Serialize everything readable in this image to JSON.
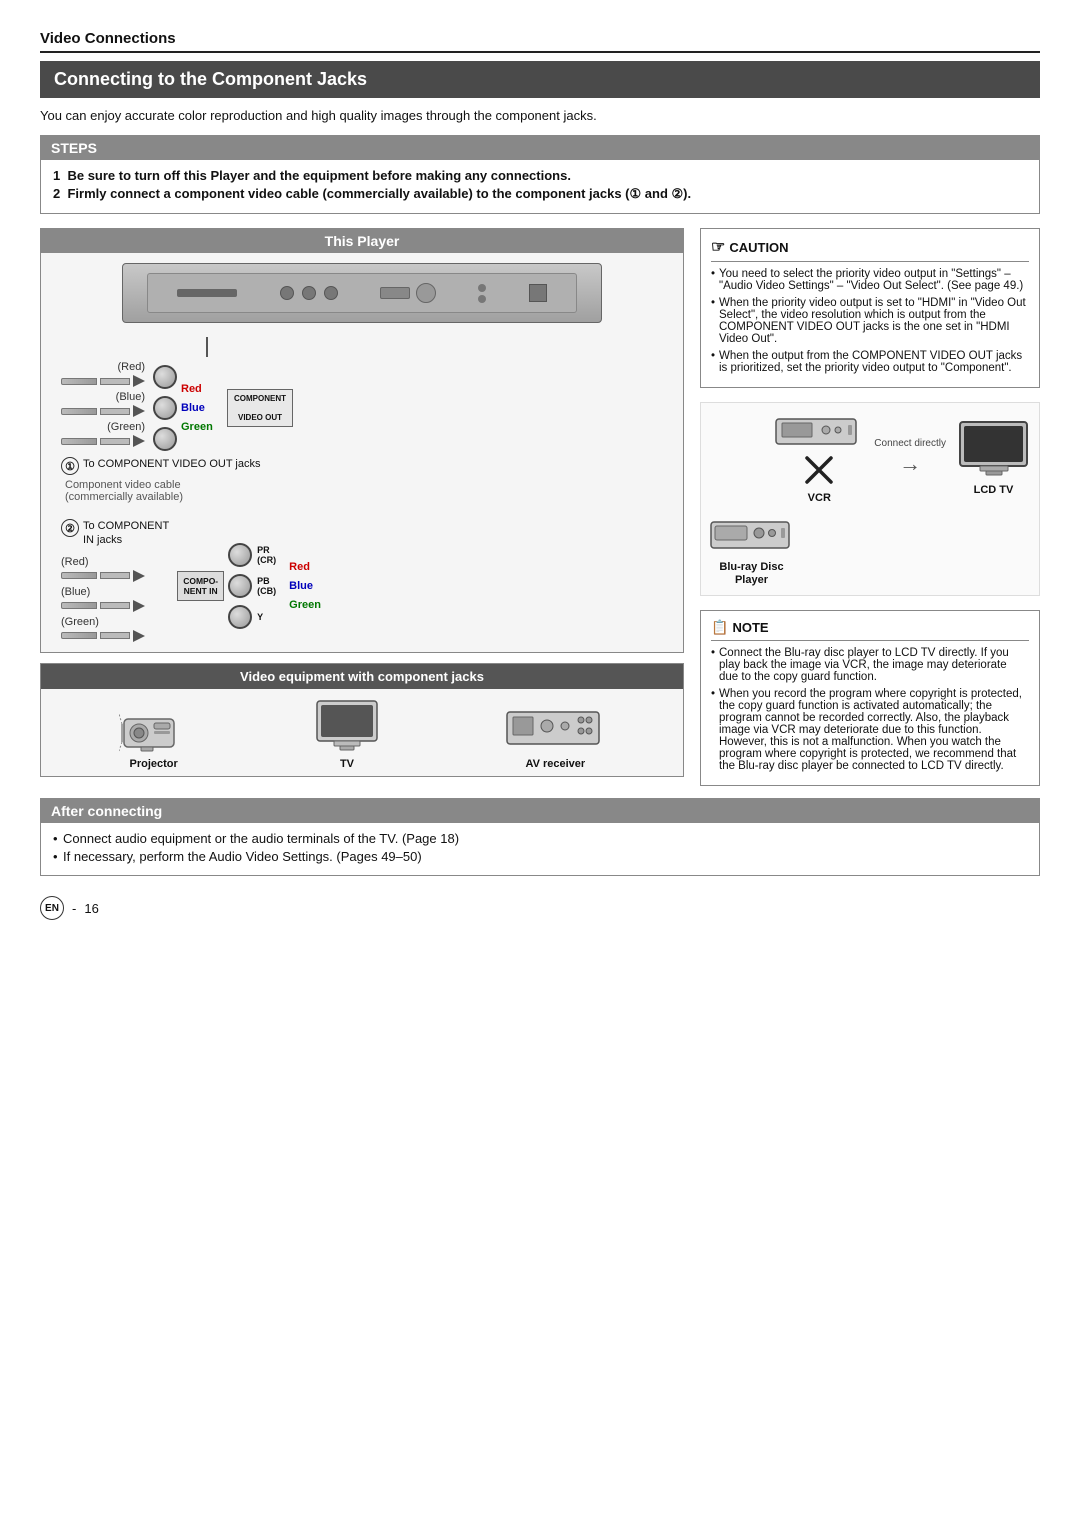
{
  "page": {
    "section_title": "Video Connections",
    "main_title": "Connecting to the Component Jacks",
    "intro": "You can enjoy accurate color reproduction and high quality images through the component jacks.",
    "steps": {
      "header": "STEPS",
      "items": [
        "Be sure to turn off this Player and the equipment before making any connections.",
        "Firmly connect a component video cable (commercially available) to the component jacks (① and ②)."
      ]
    },
    "this_player_label": "This Player",
    "component_out_label": "COMPONENT\nVIDEO OUT",
    "component_in_label": "COMPO-\nNENT IN",
    "conn1_label": "To COMPONENT\nVIDEO OUT jacks",
    "conn2_label": "To COMPONENT\nIN jacks",
    "cable_info": "Component video cable\n(commercially available)",
    "colors": {
      "red": "Red",
      "blue": "Blue",
      "green": "Green"
    },
    "jack_labels": {
      "pr_cr": "PR\nCR",
      "pb_cb": "PB\n(CB)",
      "y": "Y"
    },
    "caution": {
      "header": "CAUTION",
      "items": [
        "You need to select the priority video output in \"Settings\" – \"Audio Video Settings\" – \"Video Out Select\". (See page 49.)",
        "When the priority video output is set to \"HDMI\" in \"Video Out Select\", the video resolution which is output from the COMPONENT VIDEO OUT jacks is the one set in \"HDMI Video Out\".",
        "When the output from the COMPONENT VIDEO OUT jacks is prioritized, set the priority video output to \"Component\"."
      ]
    },
    "vcr_label": "VCR",
    "connect_directly": "Connect directly",
    "bluray_label": "Blu-ray Disc\nPlayer",
    "lcd_tv_label": "LCD TV",
    "note": {
      "header": "NOTE",
      "items": [
        "Connect the Blu-ray disc player to LCD TV directly. If you play back the image via VCR, the image may deteriorate due to the copy guard function.",
        "When you record the program where copyright is protected, the copy guard function is activated automatically; the program cannot be recorded correctly. Also, the playback image via VCR may deteriorate due to this function. However, this is not a malfunction. When you watch the program where copyright is protected, we recommend that the Blu-ray disc player be connected to LCD TV directly."
      ]
    },
    "video_eq_label": "Video equipment with component jacks",
    "projector_label": "Projector",
    "tv_label": "TV",
    "av_receiver_label": "AV receiver",
    "after_connecting": {
      "header": "After connecting",
      "items": [
        "Connect audio equipment or the audio terminals of the TV. (Page 18)",
        "If necessary, perform the Audio Video Settings. (Pages 49–50)"
      ]
    },
    "footer": {
      "en_badge": "EN",
      "page_num": "16"
    }
  }
}
